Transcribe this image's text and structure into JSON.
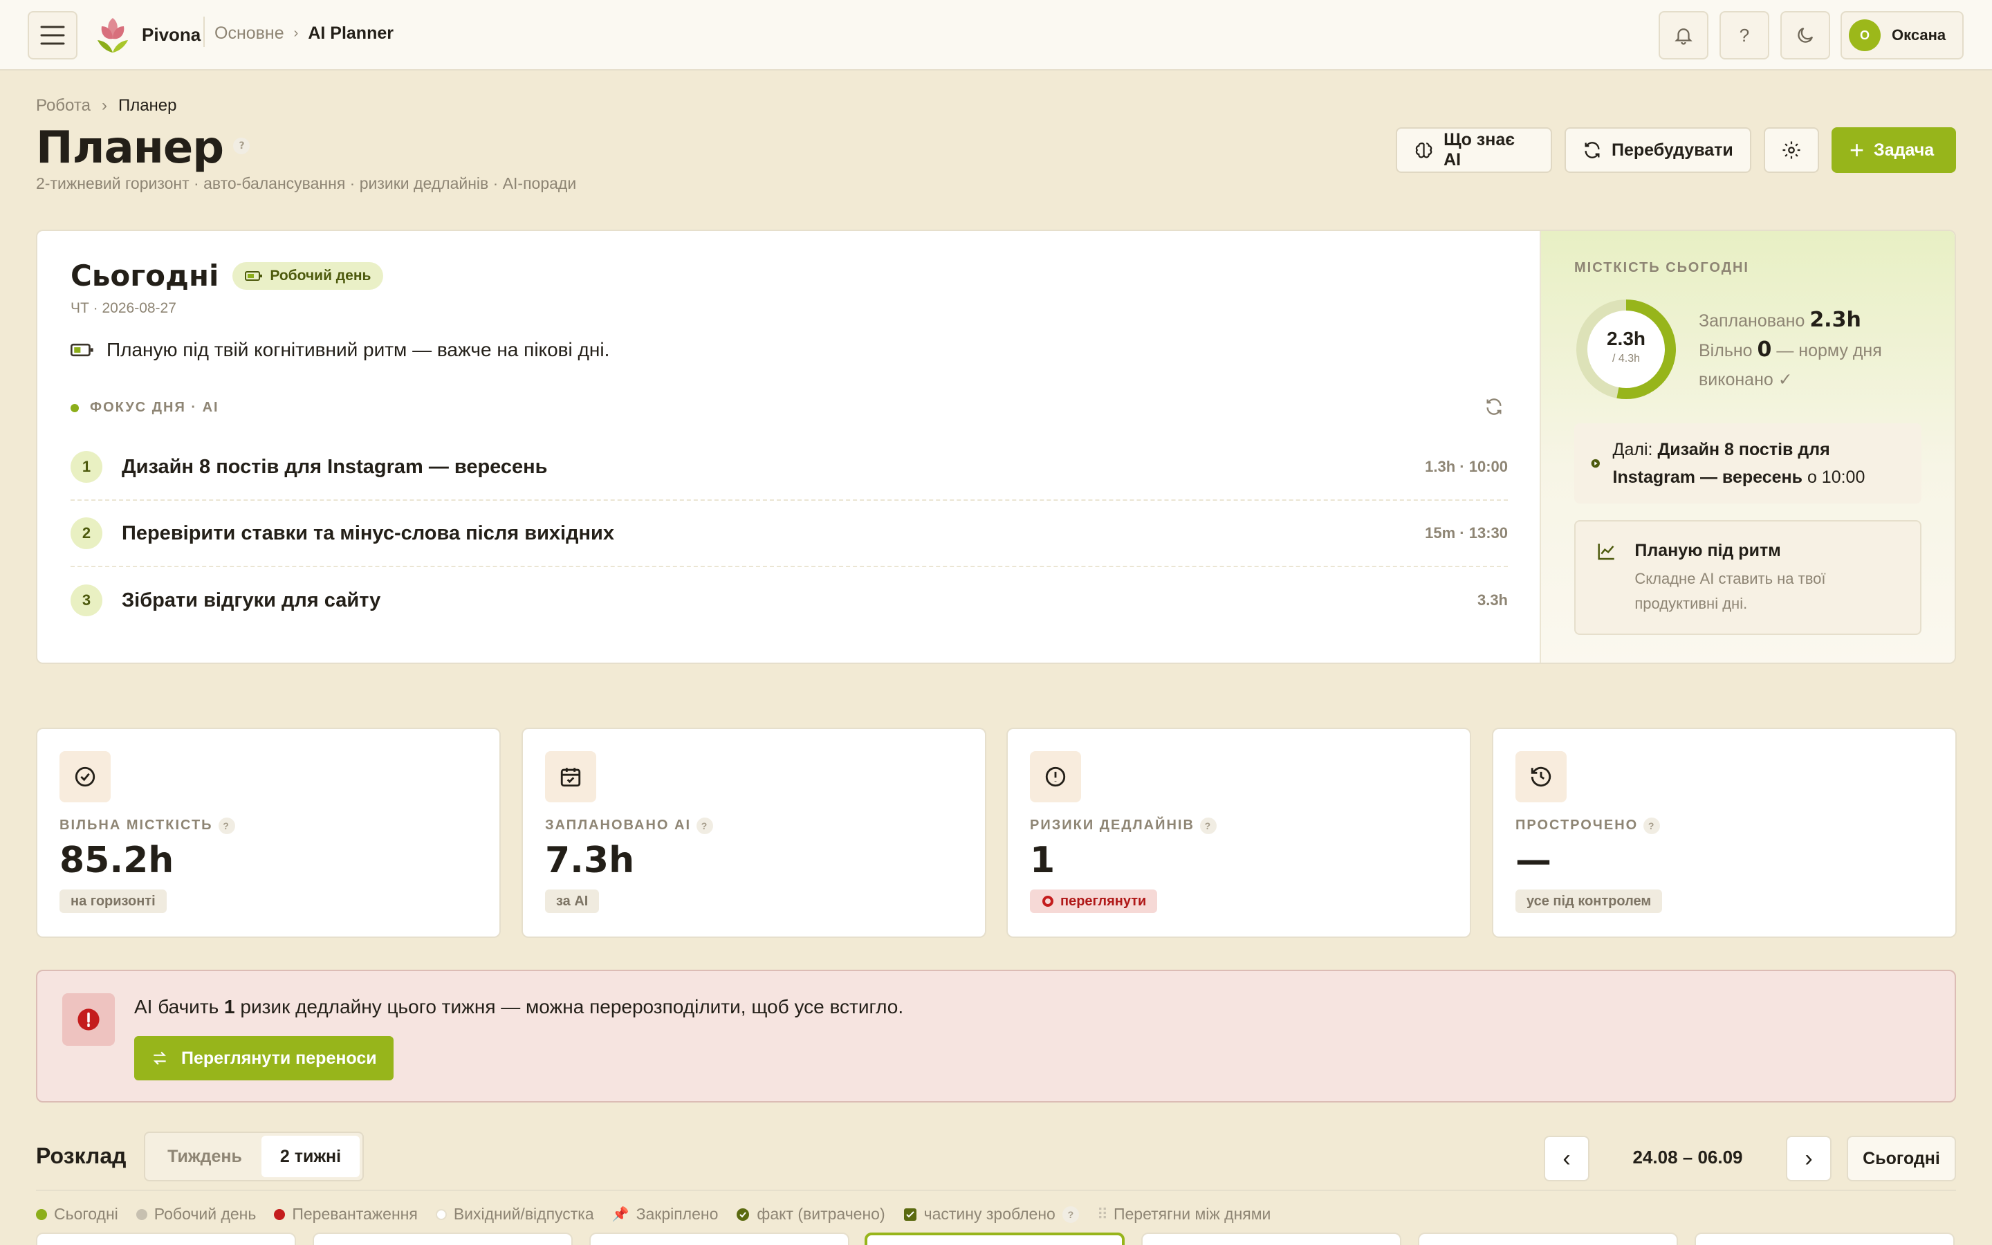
{
  "brand": {
    "name": "Pivona"
  },
  "topnav": {
    "section": "Основне",
    "page": "AI Planner"
  },
  "user": {
    "initial": "О",
    "name": "Оксана"
  },
  "breadcrumb": {
    "parent": "Робота",
    "current": "Планер"
  },
  "header": {
    "title": "Планер",
    "subtitle": "2-тижневий горизонт · авто-балансування · ризики дедлайнів · AI-поради",
    "ai_knows_label": "Що знає AI",
    "rebuild_label": "Перебудувати",
    "task_label": "Задача"
  },
  "today": {
    "title": "Сьогодні",
    "day_type": "Робочий день",
    "date": "ЧТ · 2026-08-27",
    "message": "Планую під твій когнітивний ритм — важче на пікові дні.",
    "focus_label": "ФОКУС ДНЯ · AI",
    "focus": [
      {
        "num": "1",
        "title": "Дизайн 8 постів для Instagram — вересень",
        "meta": "1.3h · 10:00"
      },
      {
        "num": "2",
        "title": "Перевірити ставки та мінус-слова після вихідних",
        "meta": "15m · 13:30"
      },
      {
        "num": "3",
        "title": "Зібрати відгуки для сайту",
        "meta": "3.3h"
      }
    ],
    "capacity": {
      "label": "МІСТКІСТЬ СЬОГОДНІ",
      "used": "2.3h",
      "total": "/ 4.3h",
      "used_fraction": 0.53,
      "planned_label": "Заплановано",
      "planned_value": "2.3h",
      "free_label": "Вільно",
      "free_value": "0",
      "free_note": "— норму дня виконано ✓"
    },
    "next": {
      "prefix": "Далі:",
      "task": "Дизайн 8 постів для Instagram — вересень",
      "time": "о 10:00"
    },
    "rhythm": {
      "title": "Планую під ритм",
      "text": "Складне AI ставить на твої продуктивні дні."
    }
  },
  "stats": [
    {
      "label": "ВІЛЬНА МІСТКІСТЬ",
      "value": "85.2h",
      "badge": "на горизонті",
      "icon": "check-circle-icon"
    },
    {
      "label": "ЗАПЛАНОВАНО AI",
      "value": "7.3h",
      "badge": "за AI",
      "icon": "calendar-check-icon"
    },
    {
      "label": "РИЗИКИ ДЕДЛАЙНІВ",
      "value": "1",
      "badge": "переглянути",
      "icon": "alert-circle-icon"
    },
    {
      "label": "ПРОСТРОЧЕНО",
      "value": "—",
      "badge": "усе під контролем",
      "icon": "history-icon"
    }
  ],
  "alert": {
    "text_before": "AI бачить",
    "count": "1",
    "text_after": "ризик дедлайну цього тижня — можна перерозподілити, щоб усе встигло.",
    "button": "Переглянути переноси"
  },
  "schedule": {
    "title": "Розклад",
    "tabs": [
      "Тиждень",
      "2 тижні"
    ],
    "active_tab": "2 тижні",
    "range": "24.08 – 06.09",
    "today_button": "Сьогодні",
    "legend": [
      "Сьогодні",
      "Робочий день",
      "Перевантаження",
      "Вихідний/відпустка",
      "Закріплено",
      "факт (витрачено)",
      "частину зроблено",
      "Перетягни між днями"
    ]
  },
  "colors": {
    "accent": "#97b51b",
    "danger": "#c41d1d",
    "background": "#f2ead4"
  }
}
